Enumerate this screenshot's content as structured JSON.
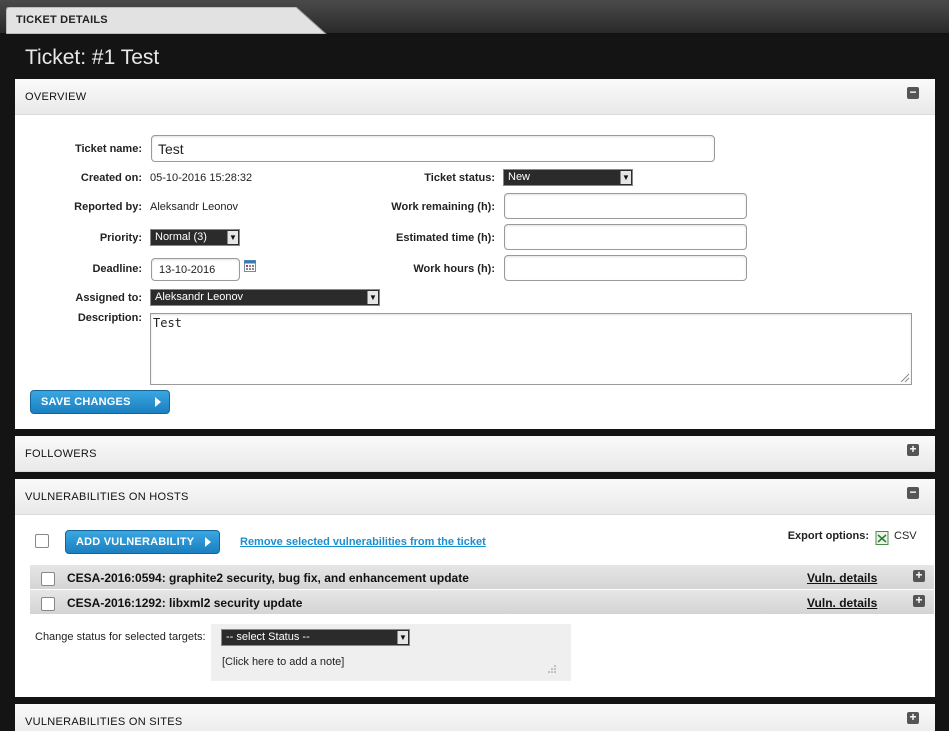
{
  "tab": {
    "label": "TICKET DETAILS"
  },
  "page": {
    "title": "Ticket: #1 Test"
  },
  "overview": {
    "title": "OVERVIEW",
    "toggle": "−",
    "ticket_name_label": "Ticket name:",
    "ticket_name_value": "Test",
    "created_on_label": "Created on:",
    "created_on_value": "05-10-2016 15:28:32",
    "reported_by_label": "Reported by:",
    "reported_by_value": "Aleksandr Leonov",
    "priority_label": "Priority:",
    "priority_value": "Normal (3)",
    "deadline_label": "Deadline:",
    "deadline_value": "13-10-2016",
    "assigned_to_label": "Assigned to:",
    "assigned_to_value": "Aleksandr Leonov",
    "description_label": "Description:",
    "description_value": "Test",
    "ticket_status_label": "Ticket status:",
    "ticket_status_value": "New",
    "work_remaining_label": "Work remaining (h):",
    "work_remaining_value": "",
    "estimated_time_label": "Estimated time (h):",
    "estimated_time_value": "",
    "work_hours_label": "Work hours (h):",
    "work_hours_value": "",
    "save_button": "SAVE CHANGES"
  },
  "followers": {
    "title": "FOLLOWERS",
    "toggle": "+"
  },
  "vulns_hosts": {
    "title": "VULNERABILITIES ON HOSTS",
    "toggle": "−",
    "add_button": "ADD VULNERABILITY",
    "remove_link": "Remove selected vulnerabilities from the ticket",
    "export_label": "Export options:",
    "export_csv": "CSV",
    "rows": [
      {
        "title": "CESA-2016:0594: graphite2 security, bug fix, and enhancement update",
        "link": "Vuln. details"
      },
      {
        "title": "CESA-2016:1292: libxml2 security update",
        "link": "Vuln. details"
      }
    ],
    "change_status_label": "Change status for selected targets:",
    "status_select": "-- select Status --",
    "note_placeholder": "[Click here to add a note]"
  },
  "vulns_sites": {
    "title": "VULNERABILITIES ON SITES",
    "toggle": "+"
  },
  "colors": {
    "accent_blue": "#1b7fc0",
    "link_blue": "#1a8fcf",
    "dark_bg": "#141414"
  }
}
